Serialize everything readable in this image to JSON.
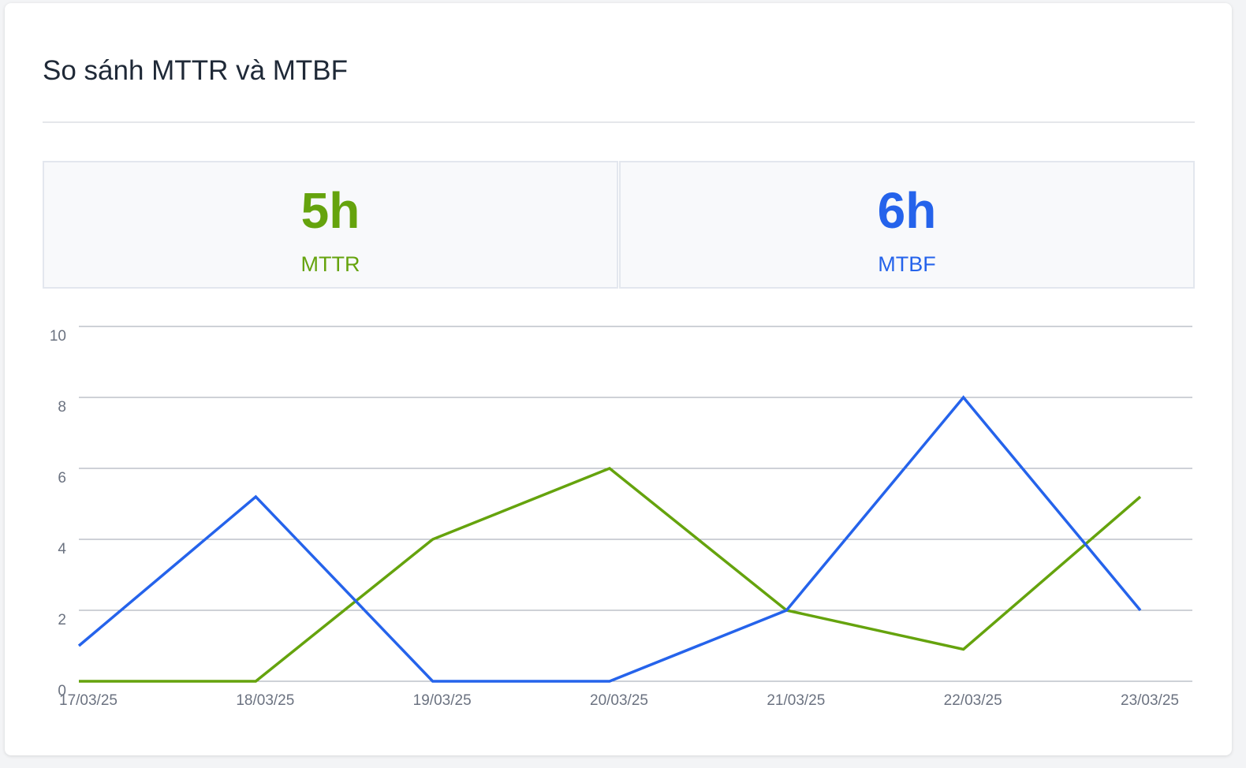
{
  "title": "So sánh MTTR và MTBF",
  "stats": {
    "mttr": {
      "value": "5h",
      "label": "MTTR",
      "color": "#65a30d"
    },
    "mtbf": {
      "value": "6h",
      "label": "MTBF",
      "color": "#2563eb"
    }
  },
  "chart_data": {
    "type": "line",
    "x": [
      "17/03/25",
      "18/03/25",
      "19/03/25",
      "20/03/25",
      "21/03/25",
      "22/03/25",
      "23/03/25"
    ],
    "y_ticks": [
      "0",
      "2",
      "4",
      "6",
      "8",
      "10"
    ],
    "ylim": [
      0,
      10
    ],
    "grid": true,
    "series": [
      {
        "color": "#65a30d",
        "values": [
          0,
          0,
          4,
          6,
          2,
          0.9,
          5.2
        ]
      },
      {
        "color": "#2563eb",
        "values": [
          1,
          5.2,
          0,
          0,
          2,
          8,
          2
        ]
      }
    ]
  }
}
